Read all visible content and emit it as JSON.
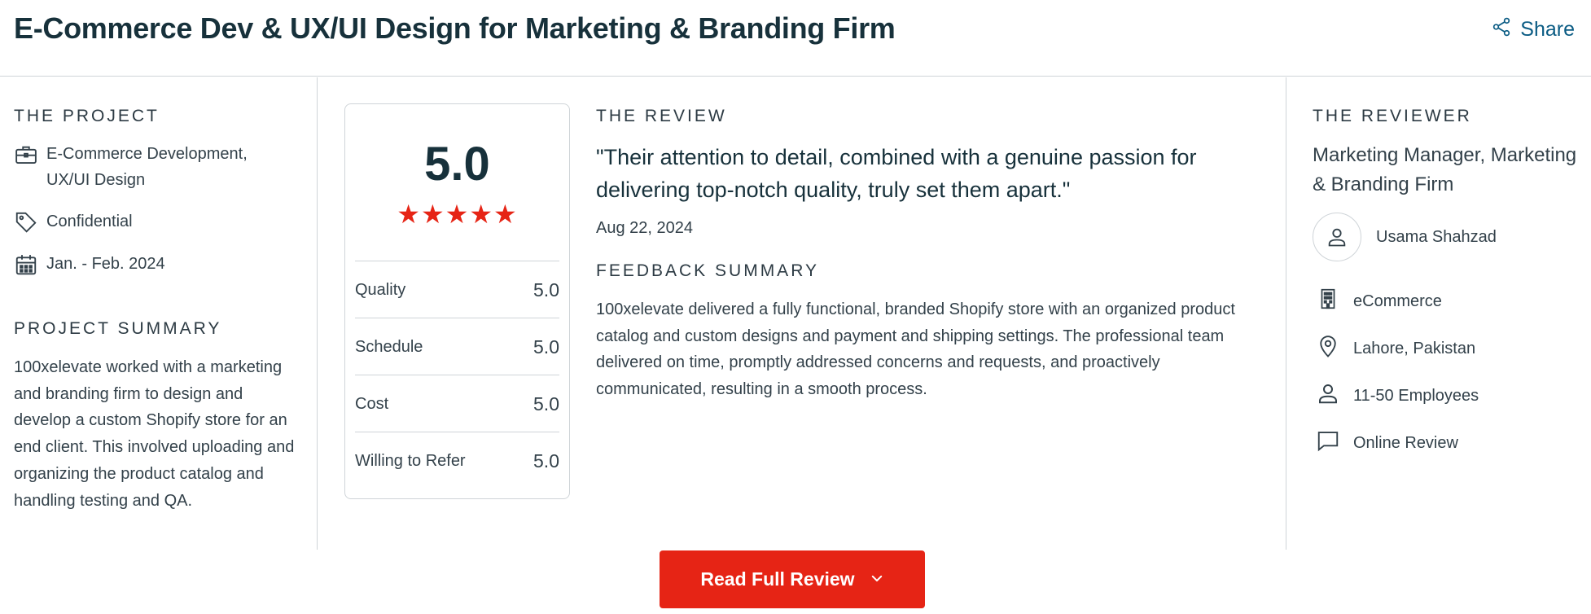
{
  "header": {
    "title": "E-Commerce Dev & UX/UI Design for Marketing & Branding Firm",
    "share_label": "Share"
  },
  "project": {
    "section_label": "THE PROJECT",
    "service": "E-Commerce Development, UX/UI Design",
    "budget": "Confidential",
    "dates": "Jan. - Feb. 2024",
    "summary_label": "PROJECT SUMMARY",
    "summary": "100xelevate worked with a marketing and branding firm to design and develop a custom Shopify store for an end client. This involved uploading and organizing the product catalog and handling testing and QA."
  },
  "scores": {
    "overall": "5.0",
    "stars": 5,
    "rows": [
      {
        "label": "Quality",
        "value": "5.0"
      },
      {
        "label": "Schedule",
        "value": "5.0"
      },
      {
        "label": "Cost",
        "value": "5.0"
      },
      {
        "label": "Willing to Refer",
        "value": "5.0"
      }
    ]
  },
  "review": {
    "section_label": "THE REVIEW",
    "quote": "\"Their attention to detail, combined with a genuine passion for delivering top-notch quality, truly set them apart.\"",
    "date": "Aug 22, 2024",
    "feedback_label": "FEEDBACK SUMMARY",
    "feedback": "100xelevate delivered a fully functional, branded Shopify store with an organized product catalog and custom designs and payment and shipping settings. The professional team delivered on time, promptly addressed concerns and requests, and proactively communicated, resulting in a smooth process."
  },
  "reviewer": {
    "section_label": "THE REVIEWER",
    "title": "Marketing Manager, Marketing & Branding Firm",
    "name": "Usama Shahzad",
    "industry": "eCommerce",
    "location": "Lahore, Pakistan",
    "size": "11-50 Employees",
    "review_type": "Online Review"
  },
  "actions": {
    "read_full_review": "Read Full Review"
  },
  "colors": {
    "accent_red": "#e62415",
    "link_blue": "#0b5c84",
    "title_text": "#17313b"
  }
}
